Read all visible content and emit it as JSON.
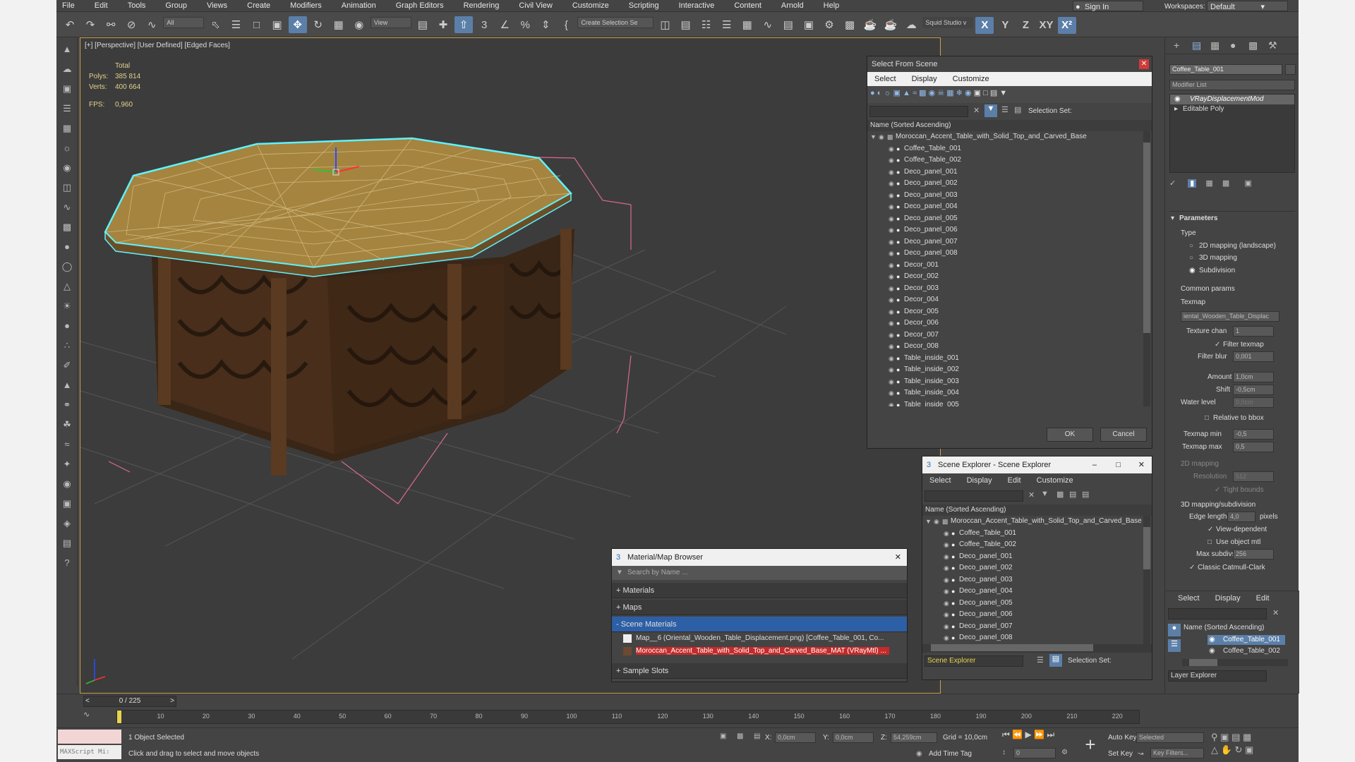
{
  "menu": [
    "File",
    "Edit",
    "Tools",
    "Group",
    "Views",
    "Create",
    "Modifiers",
    "Animation",
    "Graph Editors",
    "Rendering",
    "Civil View",
    "Customize",
    "Scripting",
    "Interactive",
    "Content",
    "Arnold",
    "Help"
  ],
  "sign_in": "Sign In",
  "workspaces_label": "Workspaces:",
  "workspace_value": "Default",
  "toolbar": {
    "filter_all": "All",
    "view_dropdown": "View",
    "create_selection_set": "Create Selection Se",
    "squid_studio": "Squid Studio v",
    "axis_x": "X",
    "axis_y": "Y",
    "axis_z": "Z",
    "axis_xy": "XY"
  },
  "viewport": {
    "label": "[+] [Perspective] [User Defined] [Edged Faces]",
    "stats_total": "Total",
    "polys_label": "Polys:",
    "polys_value": "385 814",
    "verts_label": "Verts:",
    "verts_value": "400 664",
    "fps_label": "FPS:",
    "fps_value": "0,960"
  },
  "select_from_scene": {
    "title": "Select From Scene",
    "menu": [
      "Select",
      "Display",
      "Customize"
    ],
    "selection_set_label": "Selection Set:",
    "column_header": "Name (Sorted Ascending)",
    "root": "Moroccan_Accent_Table_with_Solid_Top_and_Carved_Base",
    "items": [
      "Coffee_Table_001",
      "Coffee_Table_002",
      "Deco_panel_001",
      "Deco_panel_002",
      "Deco_panel_003",
      "Deco_panel_004",
      "Deco_panel_005",
      "Deco_panel_006",
      "Deco_panel_007",
      "Deco_panel_008",
      "Decor_001",
      "Decor_002",
      "Decor_003",
      "Decor_004",
      "Decor_005",
      "Decor_006",
      "Decor_007",
      "Decor_008",
      "Table_inside_001",
      "Table_inside_002",
      "Table_inside_003",
      "Table_inside_004",
      "Table_inside_005"
    ],
    "ok": "OK",
    "cancel": "Cancel"
  },
  "scene_explorer": {
    "title": "Scene Explorer - Scene Explorer",
    "menu": [
      "Select",
      "Display",
      "Edit",
      "Customize"
    ],
    "column_header": "Name (Sorted Ascending)",
    "root": "Moroccan_Accent_Table_with_Solid_Top_and_Carved_Base",
    "items": [
      "Coffee_Table_001",
      "Coffee_Table_002",
      "Deco_panel_001",
      "Deco_panel_002",
      "Deco_panel_003",
      "Deco_panel_004",
      "Deco_panel_005",
      "Deco_panel_006",
      "Deco_panel_007",
      "Deco_panel_008"
    ],
    "footer_dropdown": "Scene Explorer",
    "selection_set_label": "Selection Set:"
  },
  "material_browser": {
    "title": "Material/Map Browser",
    "search_placeholder": "Search by Name ...",
    "sections": [
      "+ Materials",
      "+ Maps",
      "- Scene Materials"
    ],
    "scene_items": [
      "Map__6 (Oriental_Wooden_Table_Displacement.png) [Coffee_Table_001, Co...",
      "Moroccan_Accent_Table_with_Solid_Top_and_Carved_Base_MAT (VRayMtl) ..."
    ],
    "sample_slots": "+ Sample Slots"
  },
  "command_panel": {
    "object_name": "Coffee_Table_001",
    "modifier_list": "Modifier List",
    "stack": [
      "VRayDisplacementMod",
      "Editable Poly"
    ],
    "parameters_title": "Parameters",
    "type_label": "Type",
    "type_options": [
      "2D mapping (landscape)",
      "3D mapping",
      "Subdivision"
    ],
    "common_params": "Common params",
    "texmap_label": "Texmap",
    "texmap_value": "iental_Wooden_Table_Displac",
    "texture_chan_label": "Texture chan",
    "texture_chan_value": "1",
    "filter_texmap": "Filter texmap",
    "filter_blur_label": "Filter blur",
    "filter_blur_value": "0,001",
    "amount_label": "Amount",
    "amount_value": "1,0cm",
    "shift_label": "Shift",
    "shift_value": "-0,5cm",
    "water_level_label": "Water level",
    "water_level_value": "0,0cm",
    "relative_to_bbox": "Relative to bbox",
    "texmap_min_label": "Texmap min",
    "texmap_min_value": "-0,5",
    "texmap_max_label": "Texmap max",
    "texmap_max_value": "0,5",
    "mapping_2d": "2D mapping",
    "resolution_label": "Resolution",
    "resolution_value": "512",
    "tight_bounds": "Tight bounds",
    "mapping_3d": "3D mapping/subdivision",
    "edge_length_label": "Edge length",
    "edge_length_value": "4,0",
    "pixels": "pixels",
    "view_dependent": "View-dependent",
    "use_object_mtl": "Use object mtl",
    "max_subdivs_label": "Max subdivs",
    "max_subdivs_value": "256",
    "classic_catmull": "Classic Catmull-Clark",
    "layer_menu": [
      "Select",
      "Display",
      "Edit"
    ],
    "layer_column": "Name (Sorted Ascending)",
    "layer_items": [
      "Coffee_Table_001",
      "Coffee_Table_002"
    ],
    "layer_explorer": "Layer Explorer"
  },
  "timeline": {
    "frame_counter": "0 / 225",
    "ticks": [
      "10",
      "20",
      "30",
      "40",
      "50",
      "60",
      "70",
      "80",
      "90",
      "100",
      "110",
      "120",
      "130",
      "140",
      "150",
      "160",
      "170",
      "180",
      "190",
      "200",
      "210",
      "220"
    ]
  },
  "status": {
    "maxscript": "MAXScript Mi:",
    "selected": "1 Object Selected",
    "hint": "Click and drag to select and move objects",
    "x_label": "X:",
    "x_value": "0,0cm",
    "y_label": "Y:",
    "y_value": "0,0cm",
    "z_label": "Z:",
    "z_value": "54,259cm",
    "grid": "Grid = 10,0cm",
    "add_time_tag": "Add Time Tag",
    "auto_key": "Auto Key",
    "set_key": "Set Key",
    "selected_dropdown": "Selected",
    "key_filters": "Key Filters...",
    "frame_value": "0"
  }
}
